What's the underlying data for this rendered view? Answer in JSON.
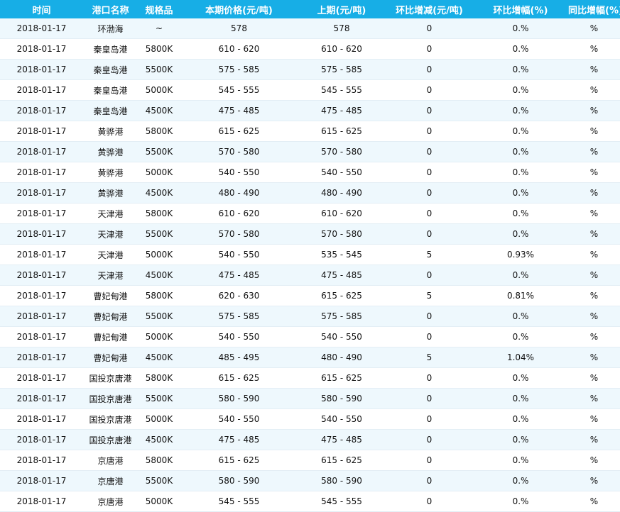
{
  "table": {
    "columns": [
      "时间",
      "港口名称",
      "规格品",
      "本期价格(元/吨)",
      "上期(元/吨)",
      "环比增减(元/吨)",
      "环比增幅(%)",
      "同比增幅(%)"
    ],
    "rows": [
      [
        "2018-01-17",
        "环渤海",
        "~",
        "578",
        "578",
        "0",
        "0.%",
        "%"
      ],
      [
        "2018-01-17",
        "秦皇岛港",
        "5800K",
        "610 - 620",
        "610 - 620",
        "0",
        "0.%",
        "%"
      ],
      [
        "2018-01-17",
        "秦皇岛港",
        "5500K",
        "575 - 585",
        "575 - 585",
        "0",
        "0.%",
        "%"
      ],
      [
        "2018-01-17",
        "秦皇岛港",
        "5000K",
        "545 - 555",
        "545 - 555",
        "0",
        "0.%",
        "%"
      ],
      [
        "2018-01-17",
        "秦皇岛港",
        "4500K",
        "475 - 485",
        "475 - 485",
        "0",
        "0.%",
        "%"
      ],
      [
        "2018-01-17",
        "黄骅港",
        "5800K",
        "615 - 625",
        "615 - 625",
        "0",
        "0.%",
        "%"
      ],
      [
        "2018-01-17",
        "黄骅港",
        "5500K",
        "570 - 580",
        "570 - 580",
        "0",
        "0.%",
        "%"
      ],
      [
        "2018-01-17",
        "黄骅港",
        "5000K",
        "540 - 550",
        "540 - 550",
        "0",
        "0.%",
        "%"
      ],
      [
        "2018-01-17",
        "黄骅港",
        "4500K",
        "480 - 490",
        "480 - 490",
        "0",
        "0.%",
        "%"
      ],
      [
        "2018-01-17",
        "天津港",
        "5800K",
        "610 - 620",
        "610 - 620",
        "0",
        "0.%",
        "%"
      ],
      [
        "2018-01-17",
        "天津港",
        "5500K",
        "570 - 580",
        "570 - 580",
        "0",
        "0.%",
        "%"
      ],
      [
        "2018-01-17",
        "天津港",
        "5000K",
        "540 - 550",
        "535 - 545",
        "5",
        "0.93%",
        "%"
      ],
      [
        "2018-01-17",
        "天津港",
        "4500K",
        "475 - 485",
        "475 - 485",
        "0",
        "0.%",
        "%"
      ],
      [
        "2018-01-17",
        "曹妃甸港",
        "5800K",
        "620 - 630",
        "615 - 625",
        "5",
        "0.81%",
        "%"
      ],
      [
        "2018-01-17",
        "曹妃甸港",
        "5500K",
        "575 - 585",
        "575 - 585",
        "0",
        "0.%",
        "%"
      ],
      [
        "2018-01-17",
        "曹妃甸港",
        "5000K",
        "540 - 550",
        "540 - 550",
        "0",
        "0.%",
        "%"
      ],
      [
        "2018-01-17",
        "曹妃甸港",
        "4500K",
        "485 - 495",
        "480 - 490",
        "5",
        "1.04%",
        "%"
      ],
      [
        "2018-01-17",
        "国投京唐港",
        "5800K",
        "615 - 625",
        "615 - 625",
        "0",
        "0.%",
        "%"
      ],
      [
        "2018-01-17",
        "国投京唐港",
        "5500K",
        "580 - 590",
        "580 - 590",
        "0",
        "0.%",
        "%"
      ],
      [
        "2018-01-17",
        "国投京唐港",
        "5000K",
        "540 - 550",
        "540 - 550",
        "0",
        "0.%",
        "%"
      ],
      [
        "2018-01-17",
        "国投京唐港",
        "4500K",
        "475 - 485",
        "475 - 485",
        "0",
        "0.%",
        "%"
      ],
      [
        "2018-01-17",
        "京唐港",
        "5800K",
        "615 - 625",
        "615 - 625",
        "0",
        "0.%",
        "%"
      ],
      [
        "2018-01-17",
        "京唐港",
        "5500K",
        "580 - 590",
        "580 - 590",
        "0",
        "0.%",
        "%"
      ],
      [
        "2018-01-17",
        "京唐港",
        "5000K",
        "545 - 555",
        "545 - 555",
        "0",
        "0.%",
        "%"
      ]
    ]
  },
  "colors": {
    "header_bg": "#17aee6",
    "header_text": "#ffffff",
    "row_stripe": "#eef8fd"
  }
}
